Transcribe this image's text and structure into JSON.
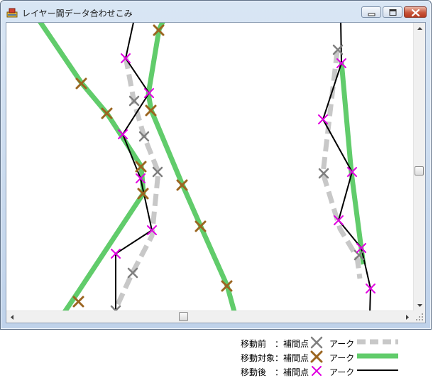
{
  "window": {
    "title": "レイヤー間データ合わせこみ"
  },
  "colors": {
    "before": "#7f7f7f",
    "before_arc": "#c8c8c8",
    "target": "#9b6520",
    "target_arc": "#61cc6b",
    "after": "#e000e0",
    "after_arc": "#000000"
  },
  "legend": {
    "rows": [
      {
        "label": "移動前　：補間点",
        "arc_label": "アーク",
        "marker_color": "#7f7f7f",
        "line_color": "#c8c8c8",
        "line_style": "dashed"
      },
      {
        "label": "移動対象：補間点",
        "arc_label": "アーク",
        "marker_color": "#9b6520",
        "line_color": "#61cc6b",
        "line_style": "solid-thick"
      },
      {
        "label": "移動後　：補間点",
        "arc_label": "アーク",
        "marker_color": "#e000e0",
        "line_color": "#000000",
        "line_style": "solid-thin"
      }
    ]
  },
  "scrollbars": {
    "vertical_position": 0.5,
    "horizontal_position": 0.45
  }
}
